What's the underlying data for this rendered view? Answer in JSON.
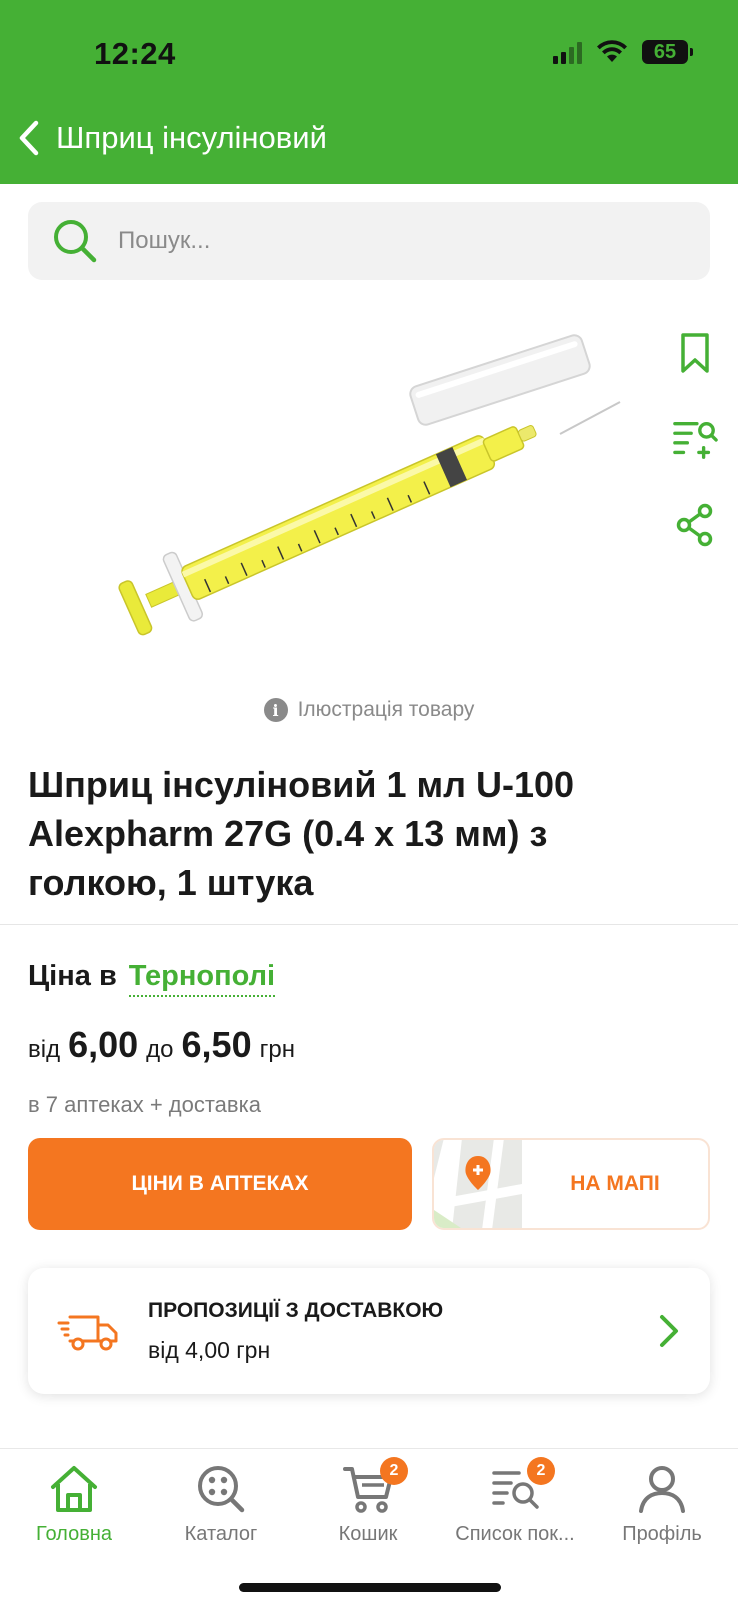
{
  "status_bar": {
    "time": "12:24",
    "battery": "65"
  },
  "header": {
    "title": "Шприц інсуліновий"
  },
  "search": {
    "placeholder": "Пошук..."
  },
  "image_note": "Ілюстрація товару",
  "product": {
    "title_line1": "Шприц інсуліновий 1 мл U-100",
    "title_line2": "Alexpharm 27G (0.4 x 13 мм) з",
    "title_line3": "голкою, 1 штука"
  },
  "price": {
    "label": "Ціна в",
    "city": "Тернополі",
    "from_label": "від",
    "from_value": "6,00",
    "to_label": "до",
    "to_value": "6,50",
    "currency": "грн",
    "stores_note": "в 7 аптеках + доставка"
  },
  "buttons": {
    "prices": "ЦІНИ В АПТЕКАХ",
    "map": "НА МАПІ"
  },
  "delivery": {
    "title": "ПРОПОЗИЦІЇ З ДОСТАВКОЮ",
    "subtitle": "від 4,00 грн"
  },
  "nav": {
    "home": "Головна",
    "catalog": "Каталог",
    "cart": "Кошик",
    "cart_badge": "2",
    "list": "Список пок...",
    "list_badge": "2",
    "profile": "Профіль"
  },
  "colors": {
    "brand_green": "#45b035",
    "accent_orange": "#f47620"
  }
}
